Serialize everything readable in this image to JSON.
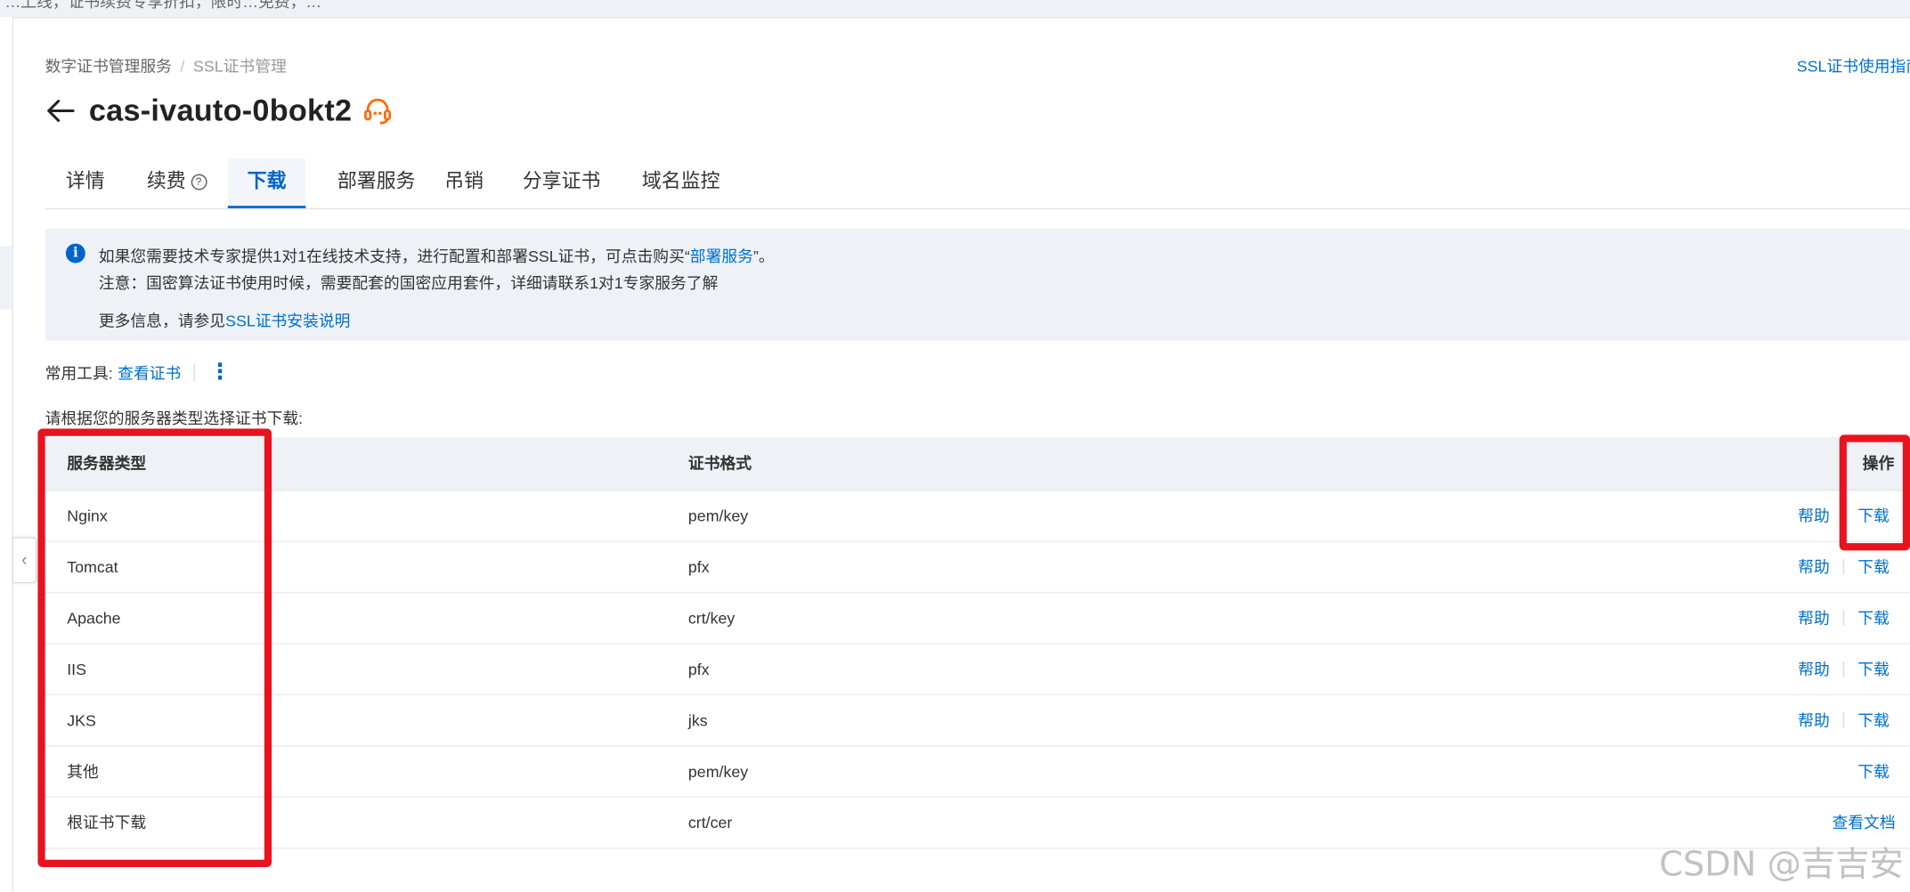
{
  "top_bar": {
    "text": "…上线，证书续费专享折扣，限时…免费，…"
  },
  "breadcrumb": {
    "root": "数字证书管理服务",
    "separator": "/",
    "current": "SSL证书管理"
  },
  "guide_link": "SSL证书使用指南",
  "page_title": "cas-ivauto-0bokt2",
  "tabs": [
    {
      "label": "详情"
    },
    {
      "label": "续费",
      "help": "?"
    },
    {
      "label": "下载",
      "active": true
    },
    {
      "label": "部署服务"
    },
    {
      "label": "吊销"
    },
    {
      "label": "分享证书"
    },
    {
      "label": "域名监控"
    }
  ],
  "notice": {
    "line1_prefix": "如果您需要技术专家提供1对1在线技术支持，进行配置和部署SSL证书，可点击购买“",
    "line1_link": "部署服务",
    "line1_suffix": "”。",
    "line2": "注意：国密算法证书使用时候，需要配套的国密应用套件，详细请联系1对1专家服务了解",
    "line3_prefix": "更多信息，请参见",
    "line3_link": "SSL证书安装说明"
  },
  "tools": {
    "label": "常用工具:",
    "link": "查看证书",
    "more": "⋮"
  },
  "choose_text": "请根据您的服务器类型选择证书下载:",
  "table": {
    "headers": {
      "server_type": "服务器类型",
      "format": "证书格式",
      "action": "操作"
    },
    "rows": [
      {
        "server_type": "Nginx",
        "format": "pem/key",
        "help": "帮助",
        "download": "下载"
      },
      {
        "server_type": "Tomcat",
        "format": "pfx",
        "help": "帮助",
        "download": "下载"
      },
      {
        "server_type": "Apache",
        "format": "crt/key",
        "help": "帮助",
        "download": "下载"
      },
      {
        "server_type": "IIS",
        "format": "pfx",
        "help": "帮助",
        "download": "下载"
      },
      {
        "server_type": "JKS",
        "format": "jks",
        "help": "帮助",
        "download": "下载"
      },
      {
        "server_type": "其他",
        "format": "pem/key",
        "help": "",
        "download": "下载"
      },
      {
        "server_type": "根证书下载",
        "format": "crt/cer",
        "help": "",
        "download": "",
        "doc": "查看文档"
      }
    ]
  },
  "watermark": "CSDN @吉吉安",
  "colors": {
    "accent": "#0064c8",
    "link": "#0070cc",
    "highlight": "#e8131f",
    "support": "#ff6a00"
  }
}
